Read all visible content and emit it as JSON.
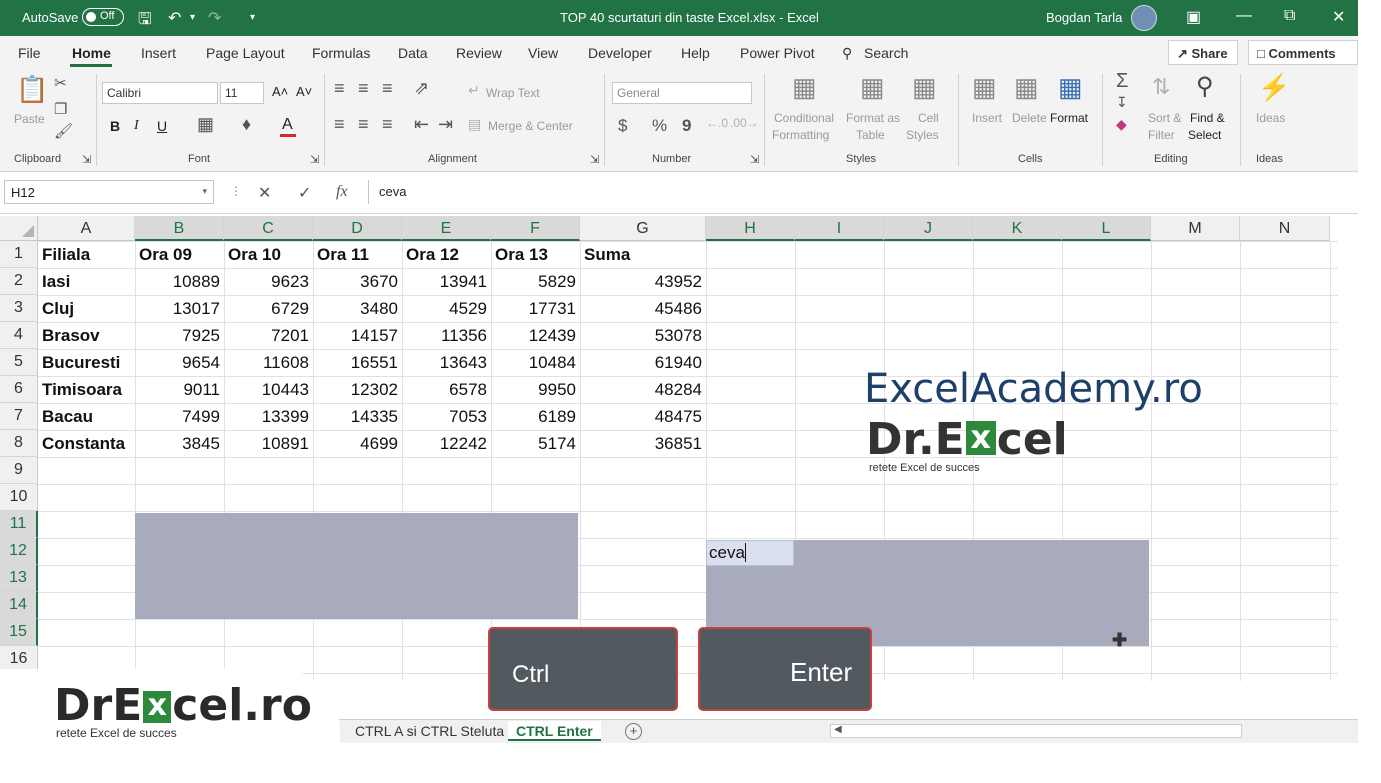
{
  "titlebar": {
    "autosave_label": "AutoSave",
    "autosave_state": "Off",
    "doc_title": "TOP 40 scurtaturi din taste Excel.xlsx  -  Excel",
    "user_name": "Bogdan Tarla"
  },
  "tabs": {
    "file": "File",
    "home": "Home",
    "insert": "Insert",
    "page_layout": "Page Layout",
    "formulas": "Formulas",
    "data": "Data",
    "review": "Review",
    "view": "View",
    "developer": "Developer",
    "help": "Help",
    "power_pivot": "Power Pivot",
    "search": "Search",
    "share": "Share",
    "comments": "Comments"
  },
  "ribbon": {
    "clipboard": {
      "label": "Clipboard",
      "paste": "Paste"
    },
    "font": {
      "label": "Font",
      "name": "Calibri",
      "size": "11",
      "bold": "B",
      "italic": "I",
      "underline": "U",
      "grow": "A˄",
      "shrink": "A˅",
      "color_letter": "A"
    },
    "alignment": {
      "label": "Alignment",
      "wrap_text": "Wrap Text",
      "merge_center": "Merge & Center"
    },
    "number": {
      "label": "Number",
      "format": "General",
      "currency": "$",
      "percent": "%",
      "comma": "9"
    },
    "styles": {
      "label": "Styles",
      "conditional_1": "Conditional",
      "conditional_2": "Formatting",
      "format_table_1": "Format as",
      "format_table_2": "Table",
      "cell_styles_1": "Cell",
      "cell_styles_2": "Styles"
    },
    "cells": {
      "label": "Cells",
      "insert": "Insert",
      "delete": "Delete",
      "format": "Format"
    },
    "editing": {
      "label": "Editing",
      "sort_1": "Sort &",
      "sort_2": "Filter",
      "find_1": "Find &",
      "find_2": "Select"
    },
    "ideas": {
      "label": "Ideas",
      "ideas": "Ideas"
    }
  },
  "formula_bar": {
    "name_box": "H12",
    "fx": "fx",
    "value": "ceva"
  },
  "columns": [
    "A",
    "B",
    "C",
    "D",
    "E",
    "F",
    "G",
    "H",
    "I",
    "J",
    "K",
    "L",
    "M",
    "N"
  ],
  "rows": [
    "1",
    "2",
    "3",
    "4",
    "5",
    "6",
    "7",
    "8",
    "9",
    "10",
    "11",
    "12",
    "13",
    "14",
    "15",
    "16"
  ],
  "sheet": {
    "headers": [
      "Filiala",
      "Ora 09",
      "Ora 10",
      "Ora 11",
      "Ora 12",
      "Ora 13",
      "Suma"
    ],
    "data": [
      [
        "Iasi",
        "10889",
        "9623",
        "3670",
        "13941",
        "5829",
        "43952"
      ],
      [
        "Cluj",
        "13017",
        "6729",
        "3480",
        "4529",
        "17731",
        "45486"
      ],
      [
        "Brasov",
        "7925",
        "7201",
        "14157",
        "11356",
        "12439",
        "53078"
      ],
      [
        "Bucuresti",
        "9654",
        "11608",
        "16551",
        "13643",
        "10484",
        "61940"
      ],
      [
        "Timisoara",
        "9011",
        "10443",
        "12302",
        "6578",
        "9950",
        "48284"
      ],
      [
        "Bacau",
        "7499",
        "13399",
        "14335",
        "7053",
        "6189",
        "48475"
      ],
      [
        "Constanta",
        "3845",
        "10891",
        "4699",
        "12242",
        "5174",
        "36851"
      ]
    ],
    "active_cell_text": "ceva"
  },
  "keys": {
    "ctrl": "Ctrl",
    "enter": "Enter"
  },
  "logo": {
    "academy": "ExcelAcademy.ro",
    "dr_before": "Dr.E",
    "dr_x": "x",
    "dr_after": "cel",
    "tagline": "retete Excel de succes"
  },
  "banner": {
    "before": "DrE",
    "x": "x",
    "after": "cel.ro",
    "tagline": "retete Excel de succes"
  },
  "sheet_tabs": {
    "tab1": "CTRL A si CTRL Steluta",
    "tab2": "CTRL Enter",
    "add": "+"
  },
  "colors": {
    "excel_green": "#217346",
    "selection": "#a7abbb",
    "key_border": "#c94040"
  }
}
